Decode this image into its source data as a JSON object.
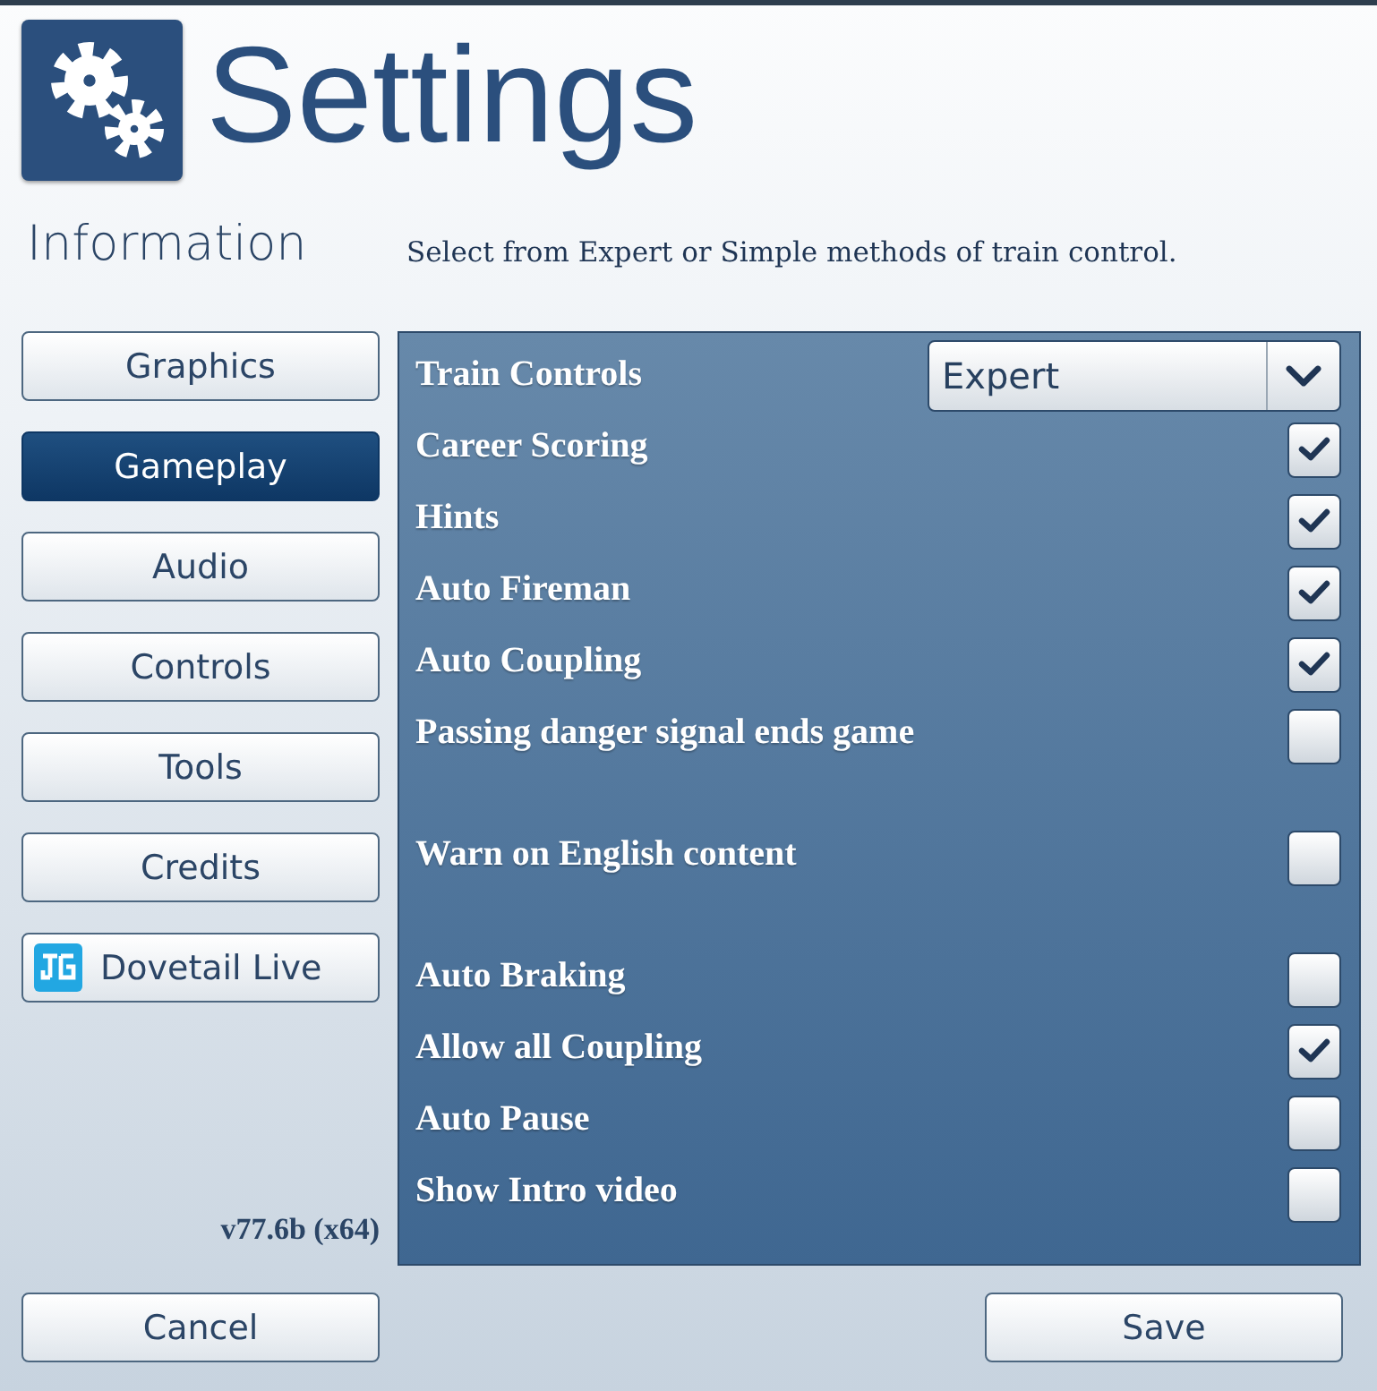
{
  "header": {
    "title": "Settings"
  },
  "sidebar": {
    "heading": "Information",
    "items": [
      {
        "label": "Graphics",
        "selected": false,
        "kind": "plain"
      },
      {
        "label": "Gameplay",
        "selected": true,
        "kind": "plain"
      },
      {
        "label": "Audio",
        "selected": false,
        "kind": "plain"
      },
      {
        "label": "Controls",
        "selected": false,
        "kind": "plain"
      },
      {
        "label": "Tools",
        "selected": false,
        "kind": "plain"
      },
      {
        "label": "Credits",
        "selected": false,
        "kind": "plain"
      },
      {
        "label": "Dovetail Live",
        "selected": false,
        "kind": "logo"
      }
    ],
    "version": "v77.6b (x64)"
  },
  "description": "Select from Expert or Simple methods of train control.",
  "groups": [
    {
      "options": [
        {
          "kind": "dropdown",
          "label": "Train Controls",
          "value": "Expert"
        },
        {
          "kind": "checkbox",
          "label": "Career Scoring",
          "checked": true
        },
        {
          "kind": "checkbox",
          "label": "Hints",
          "checked": true
        },
        {
          "kind": "checkbox",
          "label": "Auto Fireman",
          "checked": true
        },
        {
          "kind": "checkbox",
          "label": "Auto Coupling",
          "checked": true
        },
        {
          "kind": "checkbox",
          "label": "Passing danger signal ends game",
          "checked": false
        }
      ]
    },
    {
      "options": [
        {
          "kind": "checkbox",
          "label": "Warn on English content",
          "checked": false
        }
      ]
    },
    {
      "options": [
        {
          "kind": "checkbox",
          "label": "Auto Braking",
          "checked": false
        },
        {
          "kind": "checkbox",
          "label": "Allow all Coupling",
          "checked": true
        },
        {
          "kind": "checkbox",
          "label": "Auto Pause",
          "checked": false
        },
        {
          "kind": "checkbox",
          "label": "Show Intro video",
          "checked": false
        }
      ]
    }
  ],
  "buttons": [
    {
      "label": "Cancel"
    },
    {
      "label": "Save"
    }
  ]
}
